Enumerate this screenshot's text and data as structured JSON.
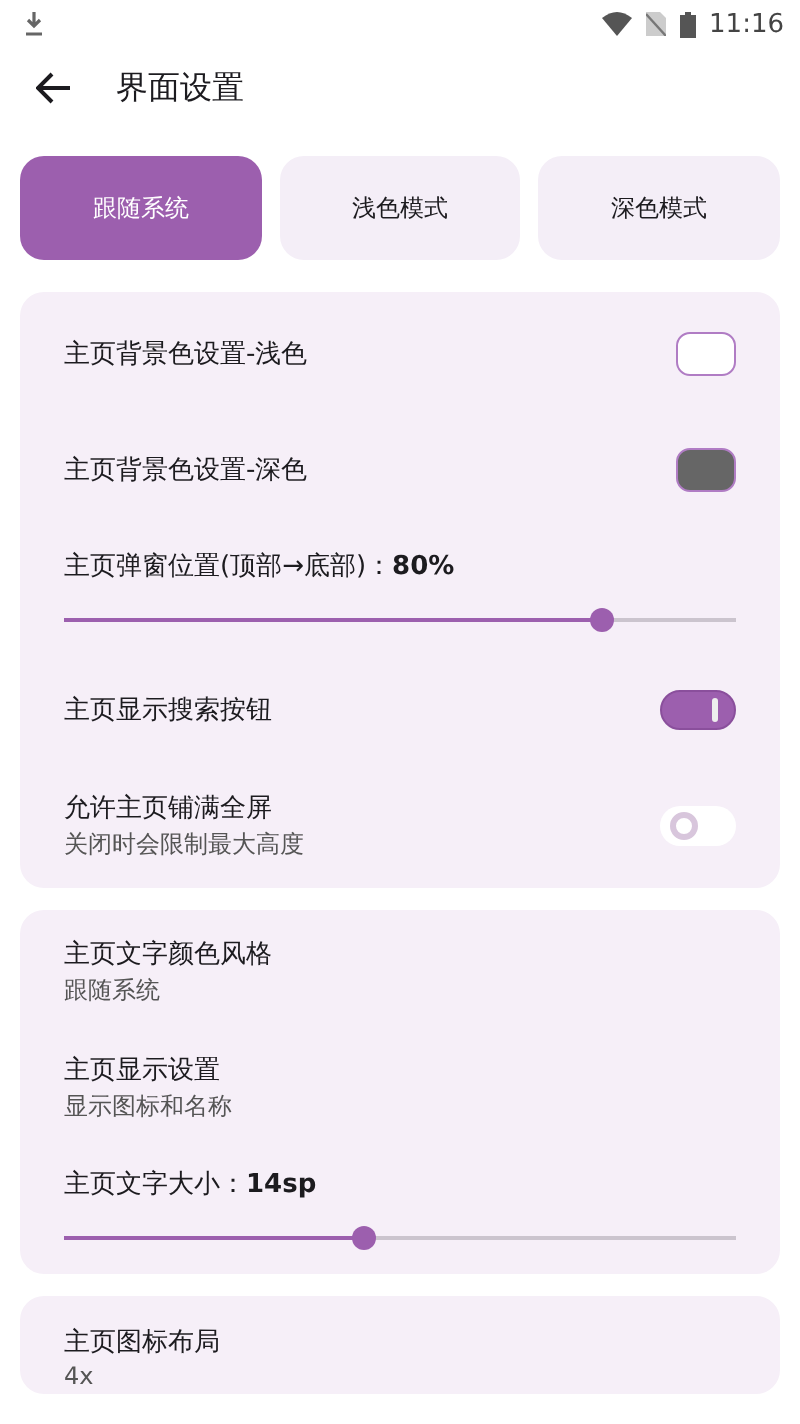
{
  "status_bar": {
    "time": "11:16"
  },
  "app_bar": {
    "title": "界面设置"
  },
  "mode_tabs": [
    {
      "label": "跟随系统",
      "selected": true
    },
    {
      "label": "浅色模式",
      "selected": false
    },
    {
      "label": "深色模式",
      "selected": false
    }
  ],
  "cards": [
    {
      "items": [
        {
          "kind": "color",
          "title": "主页背景色设置-浅色",
          "color": "#ffffff"
        },
        {
          "kind": "color",
          "title": "主页背景色设置-深色",
          "color": "#666666"
        },
        {
          "kind": "slider",
          "title": "主页弹窗位置(顶部→底部)：",
          "value": "80%",
          "level": 0.8
        },
        {
          "kind": "switch",
          "title": "主页显示搜索按钮",
          "on": true
        },
        {
          "kind": "switch",
          "title": "允许主页铺满全屏",
          "subtitle": "关闭时会限制最大高度",
          "on": false
        }
      ]
    },
    {
      "items": [
        {
          "kind": "text",
          "title": "主页文字颜色风格",
          "subtitle": "跟随系统"
        },
        {
          "kind": "text",
          "title": "主页显示设置",
          "subtitle": "显示图标和名称"
        },
        {
          "kind": "slider",
          "title": "主页文字大小：",
          "value": "14sp",
          "level": 0.445
        }
      ]
    },
    {
      "items": [
        {
          "kind": "text",
          "title": "主页图标布局",
          "subtitle": "4x"
        }
      ]
    }
  ]
}
